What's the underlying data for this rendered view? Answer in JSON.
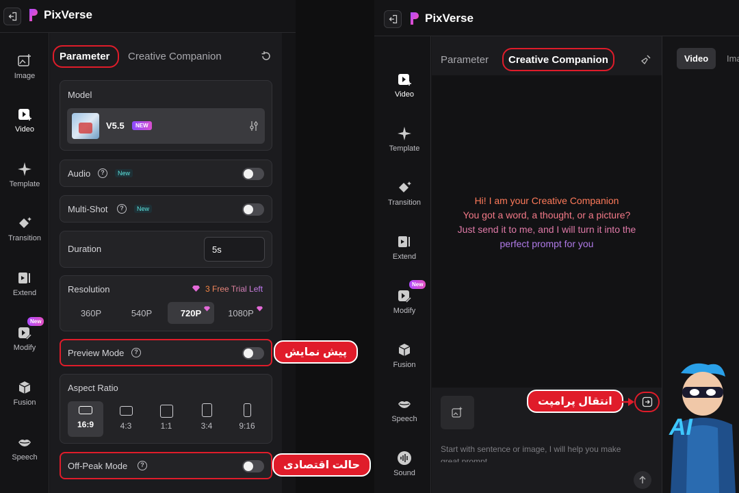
{
  "app": {
    "name": "PixVerse"
  },
  "left_nav": {
    "items": [
      {
        "label": "Image",
        "icon": "image-plus-icon"
      },
      {
        "label": "Video",
        "icon": "video-plus-icon"
      },
      {
        "label": "Template",
        "icon": "sparkle-icon"
      },
      {
        "label": "Transition",
        "icon": "transition-icon"
      },
      {
        "label": "Extend",
        "icon": "extend-icon"
      },
      {
        "label": "Modify",
        "icon": "modify-icon",
        "badge": "New"
      },
      {
        "label": "Fusion",
        "icon": "fusion-cube-icon"
      },
      {
        "label": "Speech",
        "icon": "lips-icon"
      }
    ]
  },
  "right_nav": {
    "items": [
      {
        "label": "Video",
        "icon": "video-plus-icon"
      },
      {
        "label": "Template",
        "icon": "sparkle-icon"
      },
      {
        "label": "Transition",
        "icon": "transition-icon"
      },
      {
        "label": "Extend",
        "icon": "extend-icon"
      },
      {
        "label": "Modify",
        "icon": "modify-icon",
        "badge": "New"
      },
      {
        "label": "Fusion",
        "icon": "fusion-cube-icon"
      },
      {
        "label": "Speech",
        "icon": "lips-icon"
      },
      {
        "label": "Sound",
        "icon": "sound-wave-icon"
      }
    ]
  },
  "left_panel": {
    "tabs": {
      "parameter": "Parameter",
      "creative": "Creative Companion"
    },
    "model": {
      "label": "Model",
      "name": "V5.5",
      "badge": "NEW"
    },
    "audio": {
      "label": "Audio",
      "tag": "New"
    },
    "multishot": {
      "label": "Multi-Shot",
      "tag": "New"
    },
    "duration": {
      "label": "Duration",
      "value": "5s"
    },
    "resolution": {
      "label": "Resolution",
      "trial": "3 Free Trial Left",
      "options": [
        "360P",
        "540P",
        "720P",
        "1080P"
      ],
      "selected": "720P"
    },
    "preview": {
      "label": "Preview Mode"
    },
    "aspect": {
      "label": "Aspect Ratio",
      "options": [
        "16:9",
        "4:3",
        "1:1",
        "3:4",
        "9:16"
      ],
      "selected": "16:9"
    },
    "offpeak": {
      "label": "Off-Peak Mode"
    }
  },
  "right_panel": {
    "tabs": {
      "parameter": "Parameter",
      "creative": "Creative Companion"
    },
    "side_tabs": {
      "video": "Video",
      "image": "Ima"
    },
    "chat_intro": {
      "line1": "Hi! I am your Creative Companion",
      "line2": "You got a word, a thought, or a picture?",
      "line3": "Just send it to me, and I will turn it into the",
      "line4": "perfect prompt for you"
    },
    "input_placeholder": "Start with sentence or image, I will help you make great prompt"
  },
  "annotations": {
    "preview": "پیش نمایش",
    "offpeak": "حالت اقتصادی",
    "transfer": "انتقال پرامپت"
  },
  "mascot": {
    "text": "AI"
  },
  "colors": {
    "accent_red": "#e01c2a",
    "brand_gradient_start": "#b04bff",
    "brand_gradient_end": "#ff4fa8"
  }
}
